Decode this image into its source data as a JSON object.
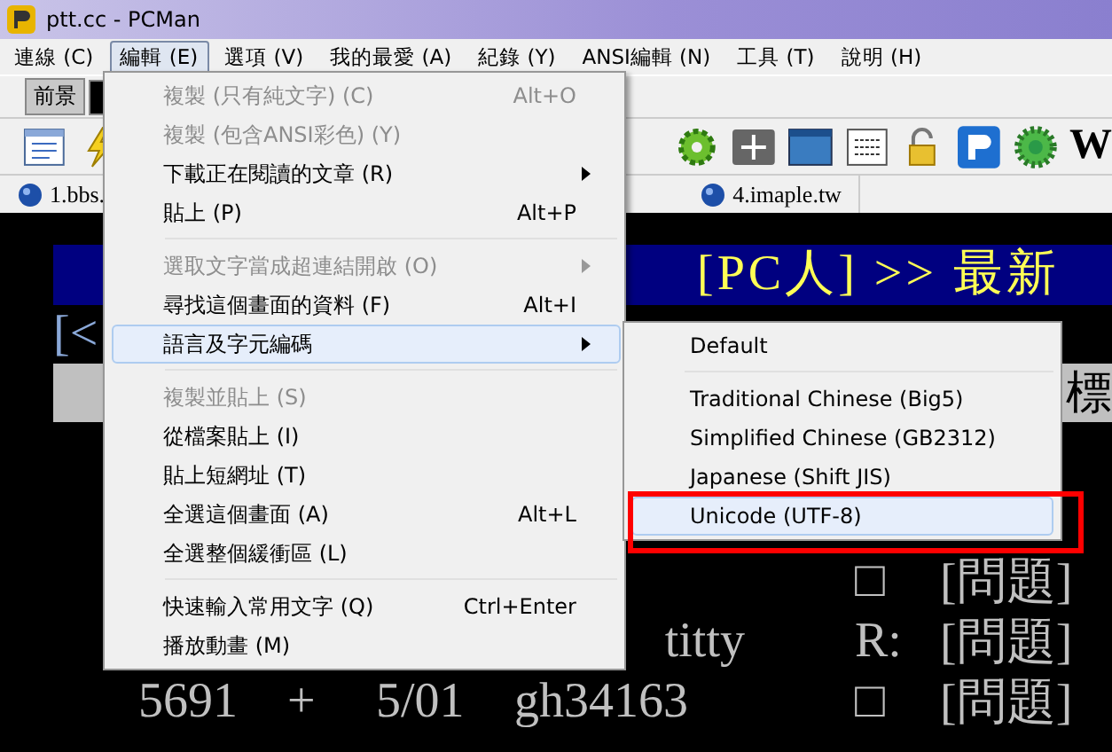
{
  "window": {
    "title": "ptt.cc - PCMan"
  },
  "menubar": [
    {
      "label": "連線 (C)",
      "selected": false
    },
    {
      "label": "編輯 (E)",
      "selected": true
    },
    {
      "label": "選項 (V)",
      "selected": false
    },
    {
      "label": "我的最愛 (A)",
      "selected": false
    },
    {
      "label": "紀錄 (Y)",
      "selected": false
    },
    {
      "label": "ANSI編輯 (N)",
      "selected": false
    },
    {
      "label": "工具 (T)",
      "selected": false
    },
    {
      "label": "說明 (H)",
      "selected": false
    }
  ],
  "color_toolbar": {
    "foreground_button": "前景"
  },
  "toolbar_logo_letter": "W",
  "tabs": [
    {
      "label": "1.bbs."
    },
    {
      "label": "4.imaple.tw"
    }
  ],
  "terminal": {
    "banner": "[PC人] >> 最新",
    "line_2": "[<",
    "line_3": "標",
    "rows": [
      {
        "kind": "full",
        "status": "□",
        "title": "[問題]"
      },
      {
        "kind": "partial",
        "author": "titty",
        "status": "R:",
        "title": "[問題]"
      },
      {
        "kind": "full",
        "num": "5691",
        "mark": "+",
        "date": "5/01",
        "author": "gh34163",
        "status": "□",
        "title": "[問題]"
      }
    ]
  },
  "edit_menu": [
    {
      "kind": "item",
      "label": "複製 (只有純文字) (C)",
      "shortcut": "Alt+O",
      "disabled": true,
      "submenu": false,
      "selected": false
    },
    {
      "kind": "item",
      "label": "複製 (包含ANSI彩色) (Y)",
      "disabled": true,
      "submenu": false,
      "selected": false
    },
    {
      "kind": "item",
      "label": "下載正在閱讀的文章 (R)",
      "disabled": false,
      "submenu": true,
      "selected": false
    },
    {
      "kind": "item",
      "label": "貼上 (P)",
      "shortcut": "Alt+P",
      "disabled": false,
      "submenu": false,
      "selected": false
    },
    {
      "kind": "separator"
    },
    {
      "kind": "item",
      "label": "選取文字當成超連結開啟 (O)",
      "disabled": true,
      "submenu": true,
      "selected": false
    },
    {
      "kind": "item",
      "label": "尋找這個畫面的資料 (F)",
      "shortcut": "Alt+I",
      "disabled": false,
      "submenu": false,
      "selected": false
    },
    {
      "kind": "item",
      "label": "語言及字元編碼",
      "disabled": false,
      "submenu": true,
      "selected": true
    },
    {
      "kind": "separator"
    },
    {
      "kind": "item",
      "label": "複製並貼上 (S)",
      "disabled": true,
      "submenu": false,
      "selected": false
    },
    {
      "kind": "item",
      "label": "從檔案貼上 (I)",
      "disabled": false,
      "submenu": false,
      "selected": false
    },
    {
      "kind": "item",
      "label": "貼上短網址 (T)",
      "disabled": false,
      "submenu": false,
      "selected": false
    },
    {
      "kind": "item",
      "label": "全選這個畫面 (A)",
      "shortcut": "Alt+L",
      "disabled": false,
      "submenu": false,
      "selected": false
    },
    {
      "kind": "item",
      "label": "全選整個緩衝區 (L)",
      "disabled": false,
      "submenu": false,
      "selected": false
    },
    {
      "kind": "separator"
    },
    {
      "kind": "item",
      "label": "快速輸入常用文字 (Q)",
      "shortcut": "Ctrl+Enter",
      "disabled": false,
      "submenu": false,
      "selected": false
    },
    {
      "kind": "item",
      "label": "播放動畫 (M)",
      "disabled": false,
      "submenu": false,
      "selected": false
    }
  ],
  "encoding_menu": [
    {
      "kind": "item",
      "label": "Default",
      "selected": false
    },
    {
      "kind": "separator"
    },
    {
      "kind": "item",
      "label": "Traditional Chinese (Big5)",
      "selected": false
    },
    {
      "kind": "item",
      "label": "Simplified Chinese (GB2312)",
      "selected": false
    },
    {
      "kind": "item",
      "label": "Japanese (Shift JIS)",
      "selected": false
    },
    {
      "kind": "item",
      "label": "Unicode (UTF-8)",
      "selected": true
    }
  ]
}
